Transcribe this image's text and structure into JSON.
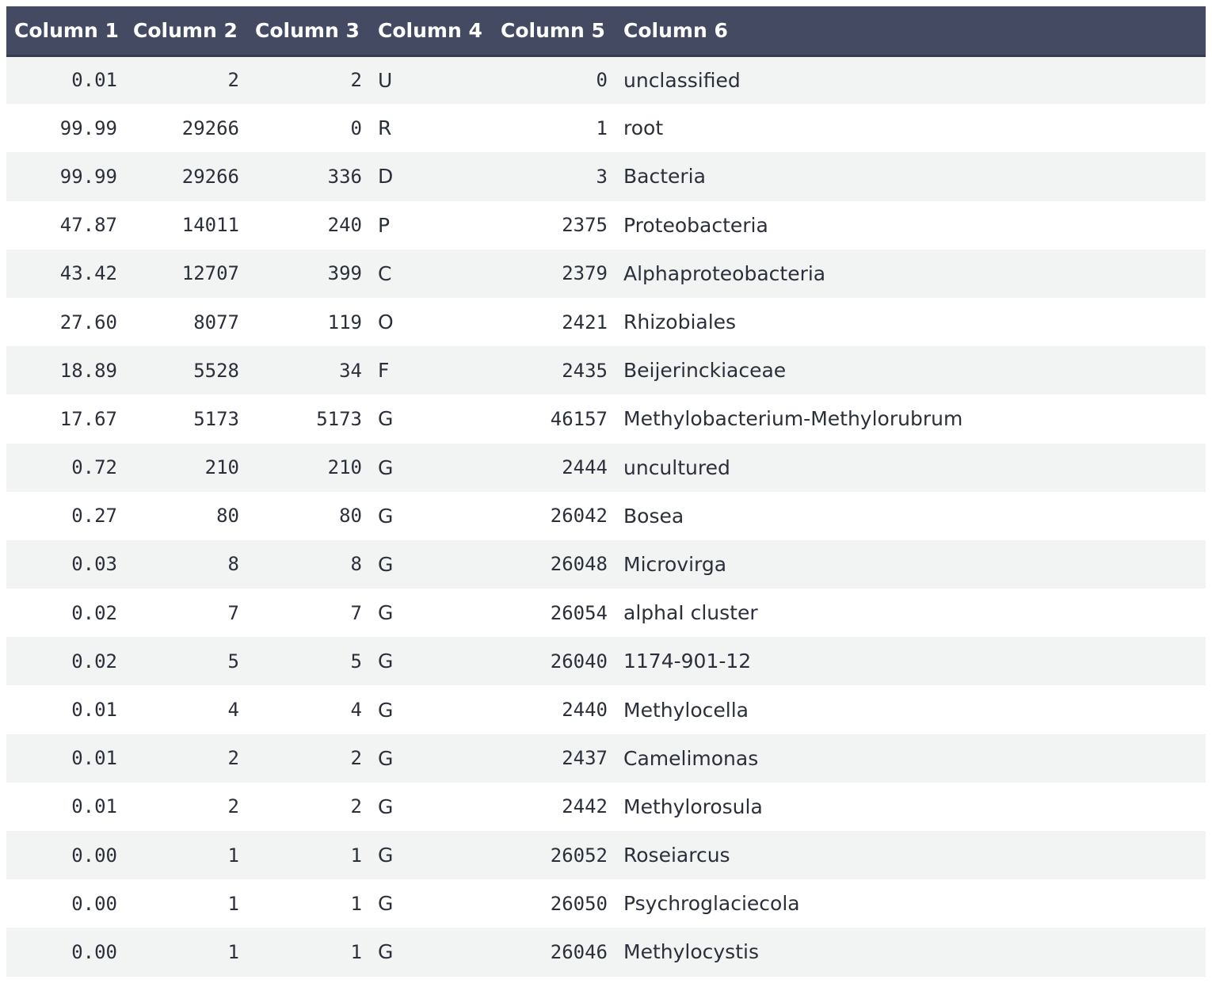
{
  "table": {
    "columns": [
      "Column 1",
      "Column 2",
      "Column 3",
      "Column 4",
      "Column 5",
      "Column 6"
    ],
    "rows": [
      [
        "0.01",
        "2",
        "2",
        "U",
        "0",
        "unclassified"
      ],
      [
        "99.99",
        "29266",
        "0",
        "R",
        "1",
        "root"
      ],
      [
        "99.99",
        "29266",
        "336",
        "D",
        "3",
        "Bacteria"
      ],
      [
        "47.87",
        "14011",
        "240",
        "P",
        "2375",
        "Proteobacteria"
      ],
      [
        "43.42",
        "12707",
        "399",
        "C",
        "2379",
        "Alphaproteobacteria"
      ],
      [
        "27.60",
        "8077",
        "119",
        "O",
        "2421",
        "Rhizobiales"
      ],
      [
        "18.89",
        "5528",
        "34",
        "F",
        "2435",
        "Beijerinckiaceae"
      ],
      [
        "17.67",
        "5173",
        "5173",
        "G",
        "46157",
        "Methylobacterium-Methylorubrum"
      ],
      [
        "0.72",
        "210",
        "210",
        "G",
        "2444",
        "uncultured"
      ],
      [
        "0.27",
        "80",
        "80",
        "G",
        "26042",
        "Bosea"
      ],
      [
        "0.03",
        "8",
        "8",
        "G",
        "26048",
        "Microvirga"
      ],
      [
        "0.02",
        "7",
        "7",
        "G",
        "26054",
        "alphaI cluster"
      ],
      [
        "0.02",
        "5",
        "5",
        "G",
        "26040",
        "1174-901-12"
      ],
      [
        "0.01",
        "4",
        "4",
        "G",
        "2440",
        "Methylocella"
      ],
      [
        "0.01",
        "2",
        "2",
        "G",
        "2437",
        "Camelimonas"
      ],
      [
        "0.01",
        "2",
        "2",
        "G",
        "2442",
        "Methylorosula"
      ],
      [
        "0.00",
        "1",
        "1",
        "G",
        "26052",
        "Roseiarcus"
      ],
      [
        "0.00",
        "1",
        "1",
        "G",
        "26050",
        "Psychroglaciecola"
      ],
      [
        "0.00",
        "1",
        "1",
        "G",
        "26046",
        "Methylocystis"
      ]
    ]
  }
}
